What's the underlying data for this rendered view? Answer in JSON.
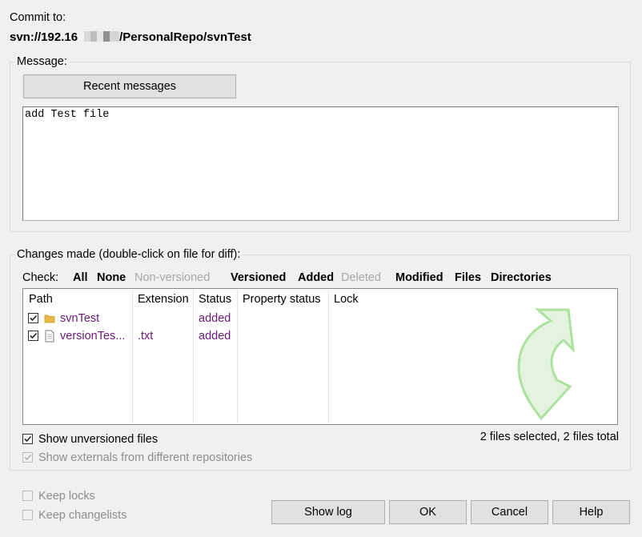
{
  "header": {
    "commit_label": "Commit to:",
    "url_prefix": "svn://192.16",
    "url_suffix": "/PersonalRepo/svnTest"
  },
  "message": {
    "group_label": "Message:",
    "recent_button": "Recent messages",
    "text": "add Test file"
  },
  "changes": {
    "group_label": "Changes made (double-click on file for diff):",
    "check_label": "Check:",
    "check_options": {
      "all": "All",
      "none": "None",
      "nonversioned": "Non-versioned",
      "versioned": "Versioned",
      "added": "Added",
      "deleted": "Deleted",
      "modified": "Modified",
      "files": "Files",
      "directories": "Directories"
    },
    "columns": {
      "path": "Path",
      "extension": "Extension",
      "status": "Status",
      "property_status": "Property status",
      "lock": "Lock"
    },
    "rows": [
      {
        "checked": true,
        "icon": "folder-icon",
        "path": "svnTest",
        "extension": "",
        "status": "added"
      },
      {
        "checked": true,
        "icon": "file-icon",
        "path": "versionTes...",
        "extension": ".txt",
        "status": "added"
      }
    ],
    "show_unversioned": "Show unversioned files",
    "show_externals": "Show externals from different repositories",
    "summary": "2 files selected, 2 files total"
  },
  "options": {
    "keep_locks": "Keep locks",
    "keep_changelists": "Keep changelists"
  },
  "buttons": {
    "show_log": "Show log",
    "ok": "OK",
    "cancel": "Cancel",
    "help": "Help"
  },
  "colors": {
    "status_added": "#6b1a7a",
    "folder": "#e8b84a",
    "watermark_arrow": "#7fd26f"
  }
}
